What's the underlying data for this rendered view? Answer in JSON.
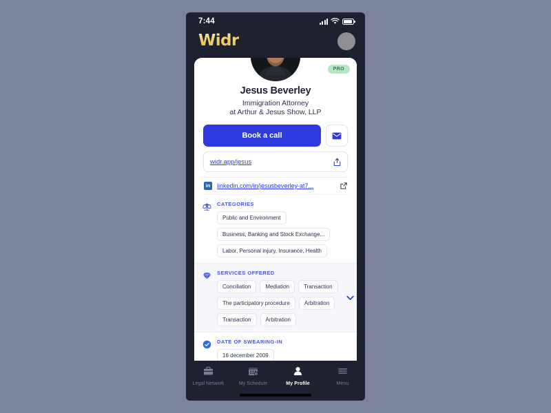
{
  "status_bar": {
    "time": "7:44",
    "signal_icon": "cellular-signal-icon",
    "wifi_icon": "wifi-icon",
    "battery_icon": "battery-icon"
  },
  "header": {
    "logo": "Widr",
    "logo_color": "#eac25a",
    "avatar_name": "header-avatar"
  },
  "profile": {
    "badge": "PRO",
    "badge_bg": "#b6e7c3",
    "badge_color": "#2f7d4e",
    "name": "Jesus Beverley",
    "title": "Immigration Attorney",
    "firm": "at  Arthur & Jesus Show, LLP",
    "book_call_label": "Book a call",
    "book_call_color": "#2e3ae0",
    "email_icon": "envelope-icon",
    "profile_url": "widr.app/jesus",
    "share_icon": "share-icon",
    "linkedin_icon": "linkedin-icon",
    "linkedin_label": "in",
    "linkedin_url": "linkedin.com/in/jesusbeverley-at7...",
    "external_link_icon": "external-link-icon"
  },
  "sections": [
    {
      "id": "categories",
      "icon": "scales-of-justice-icon",
      "title": "CATEGORIES",
      "tinted": false,
      "block_chips": true,
      "chips": [
        "Public and Environment",
        "Business, Banking and Stock Exchange...",
        "Labor, Personal injury, Insurance, Health"
      ]
    },
    {
      "id": "services-offered",
      "icon": "gem-icon",
      "title": "SERVICES OFFERED",
      "tinted": true,
      "block_chips": false,
      "expand_icon": "chevron-down-icon",
      "chips": [
        "Conciliation",
        "Mediation",
        "Transaction",
        "The participatory procedure",
        "Arbitration",
        "Transaction",
        "Arbitration"
      ]
    },
    {
      "id": "date-of-swearing-in",
      "icon": "verified-check-icon",
      "title": "DATE OF SWEARING-IN",
      "tinted": false,
      "block_chips": true,
      "chips": [
        "16 december 2009"
      ]
    }
  ],
  "tabbar": {
    "items": [
      {
        "id": "legal-network",
        "label": "Legal Network",
        "icon": "briefcase-icon",
        "active": false
      },
      {
        "id": "my-schedule",
        "label": "My Schedule",
        "icon": "calendar-icon",
        "active": false
      },
      {
        "id": "my-profile",
        "label": "My Profile",
        "icon": "person-icon",
        "active": true
      },
      {
        "id": "menu",
        "label": "Menu",
        "icon": "hamburger-menu-icon",
        "active": false
      }
    ]
  }
}
